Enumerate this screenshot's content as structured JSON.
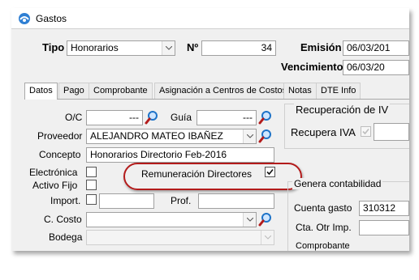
{
  "window": {
    "title": "Gastos"
  },
  "header": {
    "tipo_label": "Tipo",
    "tipo_value": "Honorarios",
    "numero_label": "Nº",
    "numero_value": "34",
    "emision_label": "Emisión",
    "emision_value": "06/03/201",
    "vencimiento_label": "Vencimiento",
    "vencimiento_value": "06/03/20"
  },
  "tabs": [
    {
      "label": "Datos"
    },
    {
      "label": "Pago"
    },
    {
      "label": "Comprobante"
    },
    {
      "label": "Asignación a Centros de Costos"
    },
    {
      "label": "Notas"
    },
    {
      "label": "DTE Info"
    }
  ],
  "datos": {
    "oc_label": "O/C",
    "oc_value": "---",
    "guia_label": "Guía",
    "guia_value": "---",
    "proveedor_label": "Proveedor",
    "proveedor_value": "ALEJANDRO MATEO IBAÑEZ",
    "concepto_label": "Concepto",
    "concepto_value": "Honorarios Directorio Feb-2016",
    "electronica_label": "Electrónica",
    "activo_fijo_label": "Activo Fijo",
    "import_label": "Import.",
    "prof_label": "Prof.",
    "remuneracion_label": "Remuneración Directores",
    "ccosto_label": "C. Costo",
    "bodega_label": "Bodega"
  },
  "recuperacion": {
    "title": "Recuperación de IV",
    "recupera_label": "Recupera IVA"
  },
  "contab": {
    "title": "Genera contabilidad",
    "cuenta_label": "Cuenta gasto",
    "cuenta_value": "310312",
    "cta_otr_label": "Cta. Otr Imp.",
    "comprobante_label": "Comprobante"
  },
  "colors": {
    "highlight": "#b31b1b",
    "accent": "#1e73c8"
  }
}
